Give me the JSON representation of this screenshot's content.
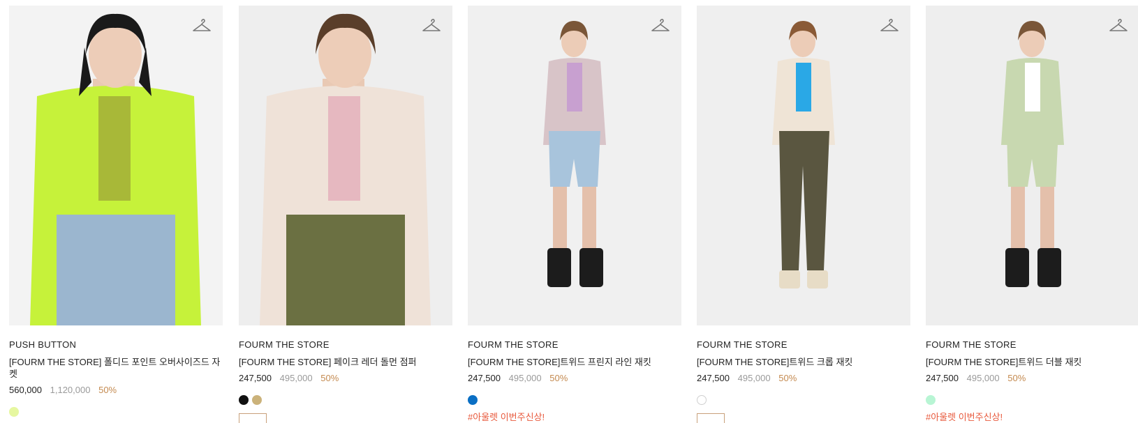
{
  "products": [
    {
      "brand": "PUSH BUTTON",
      "name": "[FOURM THE STORE] 폴디드 포인트 오버사이즈드 자켓",
      "price": "560,000",
      "original_price": "1,120,000",
      "discount": "50%",
      "swatches": [
        "#e6f7a0"
      ],
      "tag": "",
      "bg": "#f3f3f3",
      "garment": "#c6f23a",
      "inner": "#a8b838",
      "bottom": "#9bb6cf",
      "hair": "#1a1a1a"
    },
    {
      "brand": "FOURM THE STORE",
      "name": "[FOURM THE STORE] 페이크 레더 돌먼 점퍼",
      "price": "247,500",
      "original_price": "495,000",
      "discount": "50%",
      "swatches": [
        "#111111",
        "#cbb27a"
      ],
      "tag": "",
      "bg": "#eeeeee",
      "garment": "#efe2d8",
      "inner": "#e6b8c0",
      "bottom": "#6b7042",
      "hair": "#5a3e2a"
    },
    {
      "brand": "FOURM THE STORE",
      "name": "[FOURM THE STORE]트위드 프린지 라인 재킷",
      "price": "247,500",
      "original_price": "495,000",
      "discount": "50%",
      "swatches": [
        "#0a6fc4"
      ],
      "tag": "#아울렛 이번주신상!",
      "bg": "#f0f0f0",
      "garment": "#d8c4c8",
      "inner": "#c8a0d0",
      "bottom": "#a8c4dc",
      "hair": "#7a5638"
    },
    {
      "brand": "FOURM THE STORE",
      "name": "[FOURM THE STORE]트위드 크롭 재킷",
      "price": "247,500",
      "original_price": "495,000",
      "discount": "50%",
      "swatches": [
        "#ffffff"
      ],
      "tag": "",
      "bg": "#efefef",
      "garment": "#efe4d6",
      "inner": "#2aa8e6",
      "bottom": "#5a5640",
      "hair": "#8a5a36"
    },
    {
      "brand": "FOURM THE STORE",
      "name": "[FOURM THE STORE]트위드 더블 재킷",
      "price": "247,500",
      "original_price": "495,000",
      "discount": "50%",
      "swatches": [
        "#b8f5d4"
      ],
      "tag": "#아울렛 이번주신상!",
      "bg": "#eeeeee",
      "garment": "#c8d8b0",
      "inner": "#ffffff",
      "bottom": "#c8d8b0",
      "hair": "#7a5638"
    }
  ],
  "icons": {
    "wishlist": "hanger-icon"
  }
}
